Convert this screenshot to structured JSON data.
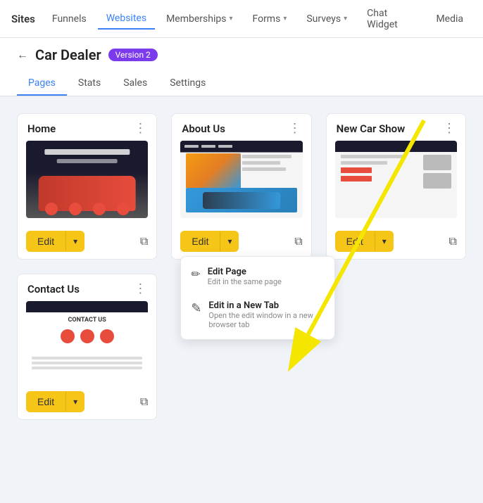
{
  "topNav": {
    "sites_label": "Sites",
    "items": [
      {
        "id": "funnels",
        "label": "Funnels",
        "has_dropdown": false,
        "active": false
      },
      {
        "id": "websites",
        "label": "Websites",
        "has_dropdown": false,
        "active": true
      },
      {
        "id": "memberships",
        "label": "Memberships",
        "has_dropdown": true,
        "active": false
      },
      {
        "id": "forms",
        "label": "Forms",
        "has_dropdown": true,
        "active": false
      },
      {
        "id": "surveys",
        "label": "Surveys",
        "has_dropdown": true,
        "active": false
      },
      {
        "id": "chat-widget",
        "label": "Chat Widget",
        "has_dropdown": false,
        "active": false
      },
      {
        "id": "media",
        "label": "Media",
        "has_dropdown": false,
        "active": false
      }
    ]
  },
  "subHeader": {
    "back_label": "←",
    "title": "Car Dealer",
    "version_badge": "Version 2",
    "tabs": [
      {
        "id": "pages",
        "label": "Pages",
        "active": true
      },
      {
        "id": "stats",
        "label": "Stats",
        "active": false
      },
      {
        "id": "sales",
        "label": "Sales",
        "active": false
      },
      {
        "id": "settings",
        "label": "Settings",
        "active": false
      }
    ]
  },
  "cards": [
    {
      "id": "home",
      "title": "Home",
      "thumb_type": "home",
      "edit_label": "Edit",
      "show_dropdown": false
    },
    {
      "id": "about-us",
      "title": "About Us",
      "thumb_type": "about",
      "edit_label": "Edit",
      "show_dropdown": true
    },
    {
      "id": "new-car-show",
      "title": "New Car Show",
      "thumb_type": "newcar",
      "edit_label": "Edit",
      "show_dropdown": false
    },
    {
      "id": "contact-us",
      "title": "Contact Us",
      "thumb_type": "contact",
      "edit_label": "Edit",
      "show_dropdown": false
    }
  ],
  "dropdown": {
    "items": [
      {
        "id": "edit-page",
        "icon": "✏️",
        "title": "Edit Page",
        "subtitle": "Edit in the same page"
      },
      {
        "id": "edit-new-tab",
        "icon": "✎",
        "title": "Edit in a New Tab",
        "subtitle": "Open the edit window in a new browser tab"
      }
    ]
  },
  "icons": {
    "back": "←",
    "three_dots": "⋮",
    "chevron_down": "▾",
    "external_link": "⧉",
    "edit_page_icon": "✏",
    "edit_tab_icon": "✎"
  },
  "colors": {
    "accent_blue": "#3b82f6",
    "edit_btn_yellow": "#f5c518",
    "version_purple": "#7c3aed",
    "nav_bg": "#ffffff",
    "body_bg": "#f0f4f8"
  }
}
